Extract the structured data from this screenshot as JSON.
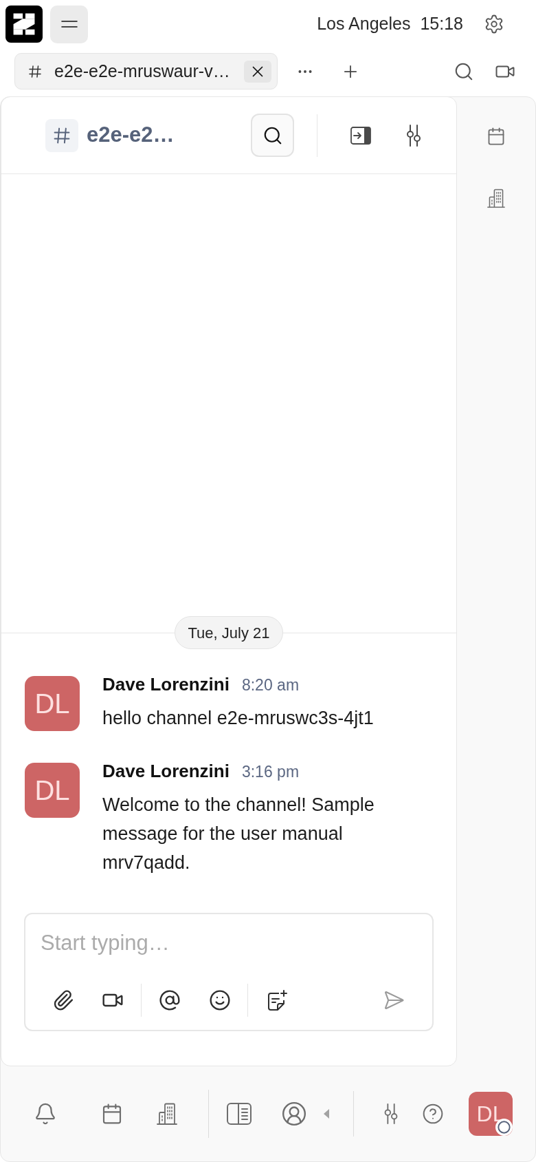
{
  "top_bar": {
    "location": "Los Angeles",
    "time": "15:18"
  },
  "tabs": [
    {
      "label": "e2e-e2e-mruswaur-v…",
      "selected": true
    }
  ],
  "channel_header": {
    "title": "e2e-e2…"
  },
  "date_separator": {
    "label": "Tue, July 21"
  },
  "messages": [
    {
      "initials": "DL",
      "author": "Dave Lorenzini",
      "time": "8:20 am",
      "text": "hello channel e2e-mruswc3s-4jt1"
    },
    {
      "initials": "DL",
      "author": "Dave Lorenzini",
      "time": "3:16 pm",
      "text": "Welcome to the channel! Sample message for the user manual mrv7qadd."
    }
  ],
  "composer": {
    "placeholder": "Start typing…"
  },
  "bottom_bar": {
    "user_initials": "DL"
  }
}
